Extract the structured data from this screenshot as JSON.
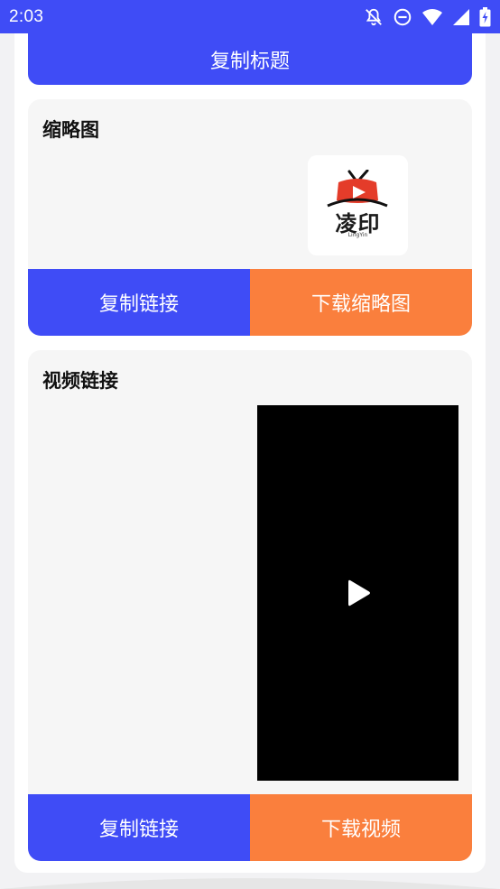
{
  "status_bar": {
    "time": "2:03",
    "icons": [
      "notifications-off-icon",
      "do-not-disturb-icon",
      "wifi-icon",
      "signal-icon",
      "battery-charging-icon"
    ]
  },
  "copy_title_button": "复制标题",
  "thumbnail_card": {
    "title": "缩略图",
    "logo_text": "凌印",
    "logo_sub": "LingYin",
    "copy_link": "复制链接",
    "download": "下载缩略图"
  },
  "video_card": {
    "title": "视频链接",
    "copy_link": "复制链接",
    "download": "下载视频"
  },
  "colors": {
    "primary": "#3f4cf6",
    "accent": "#fa7f3d",
    "card_bg": "#f6f6f6"
  }
}
